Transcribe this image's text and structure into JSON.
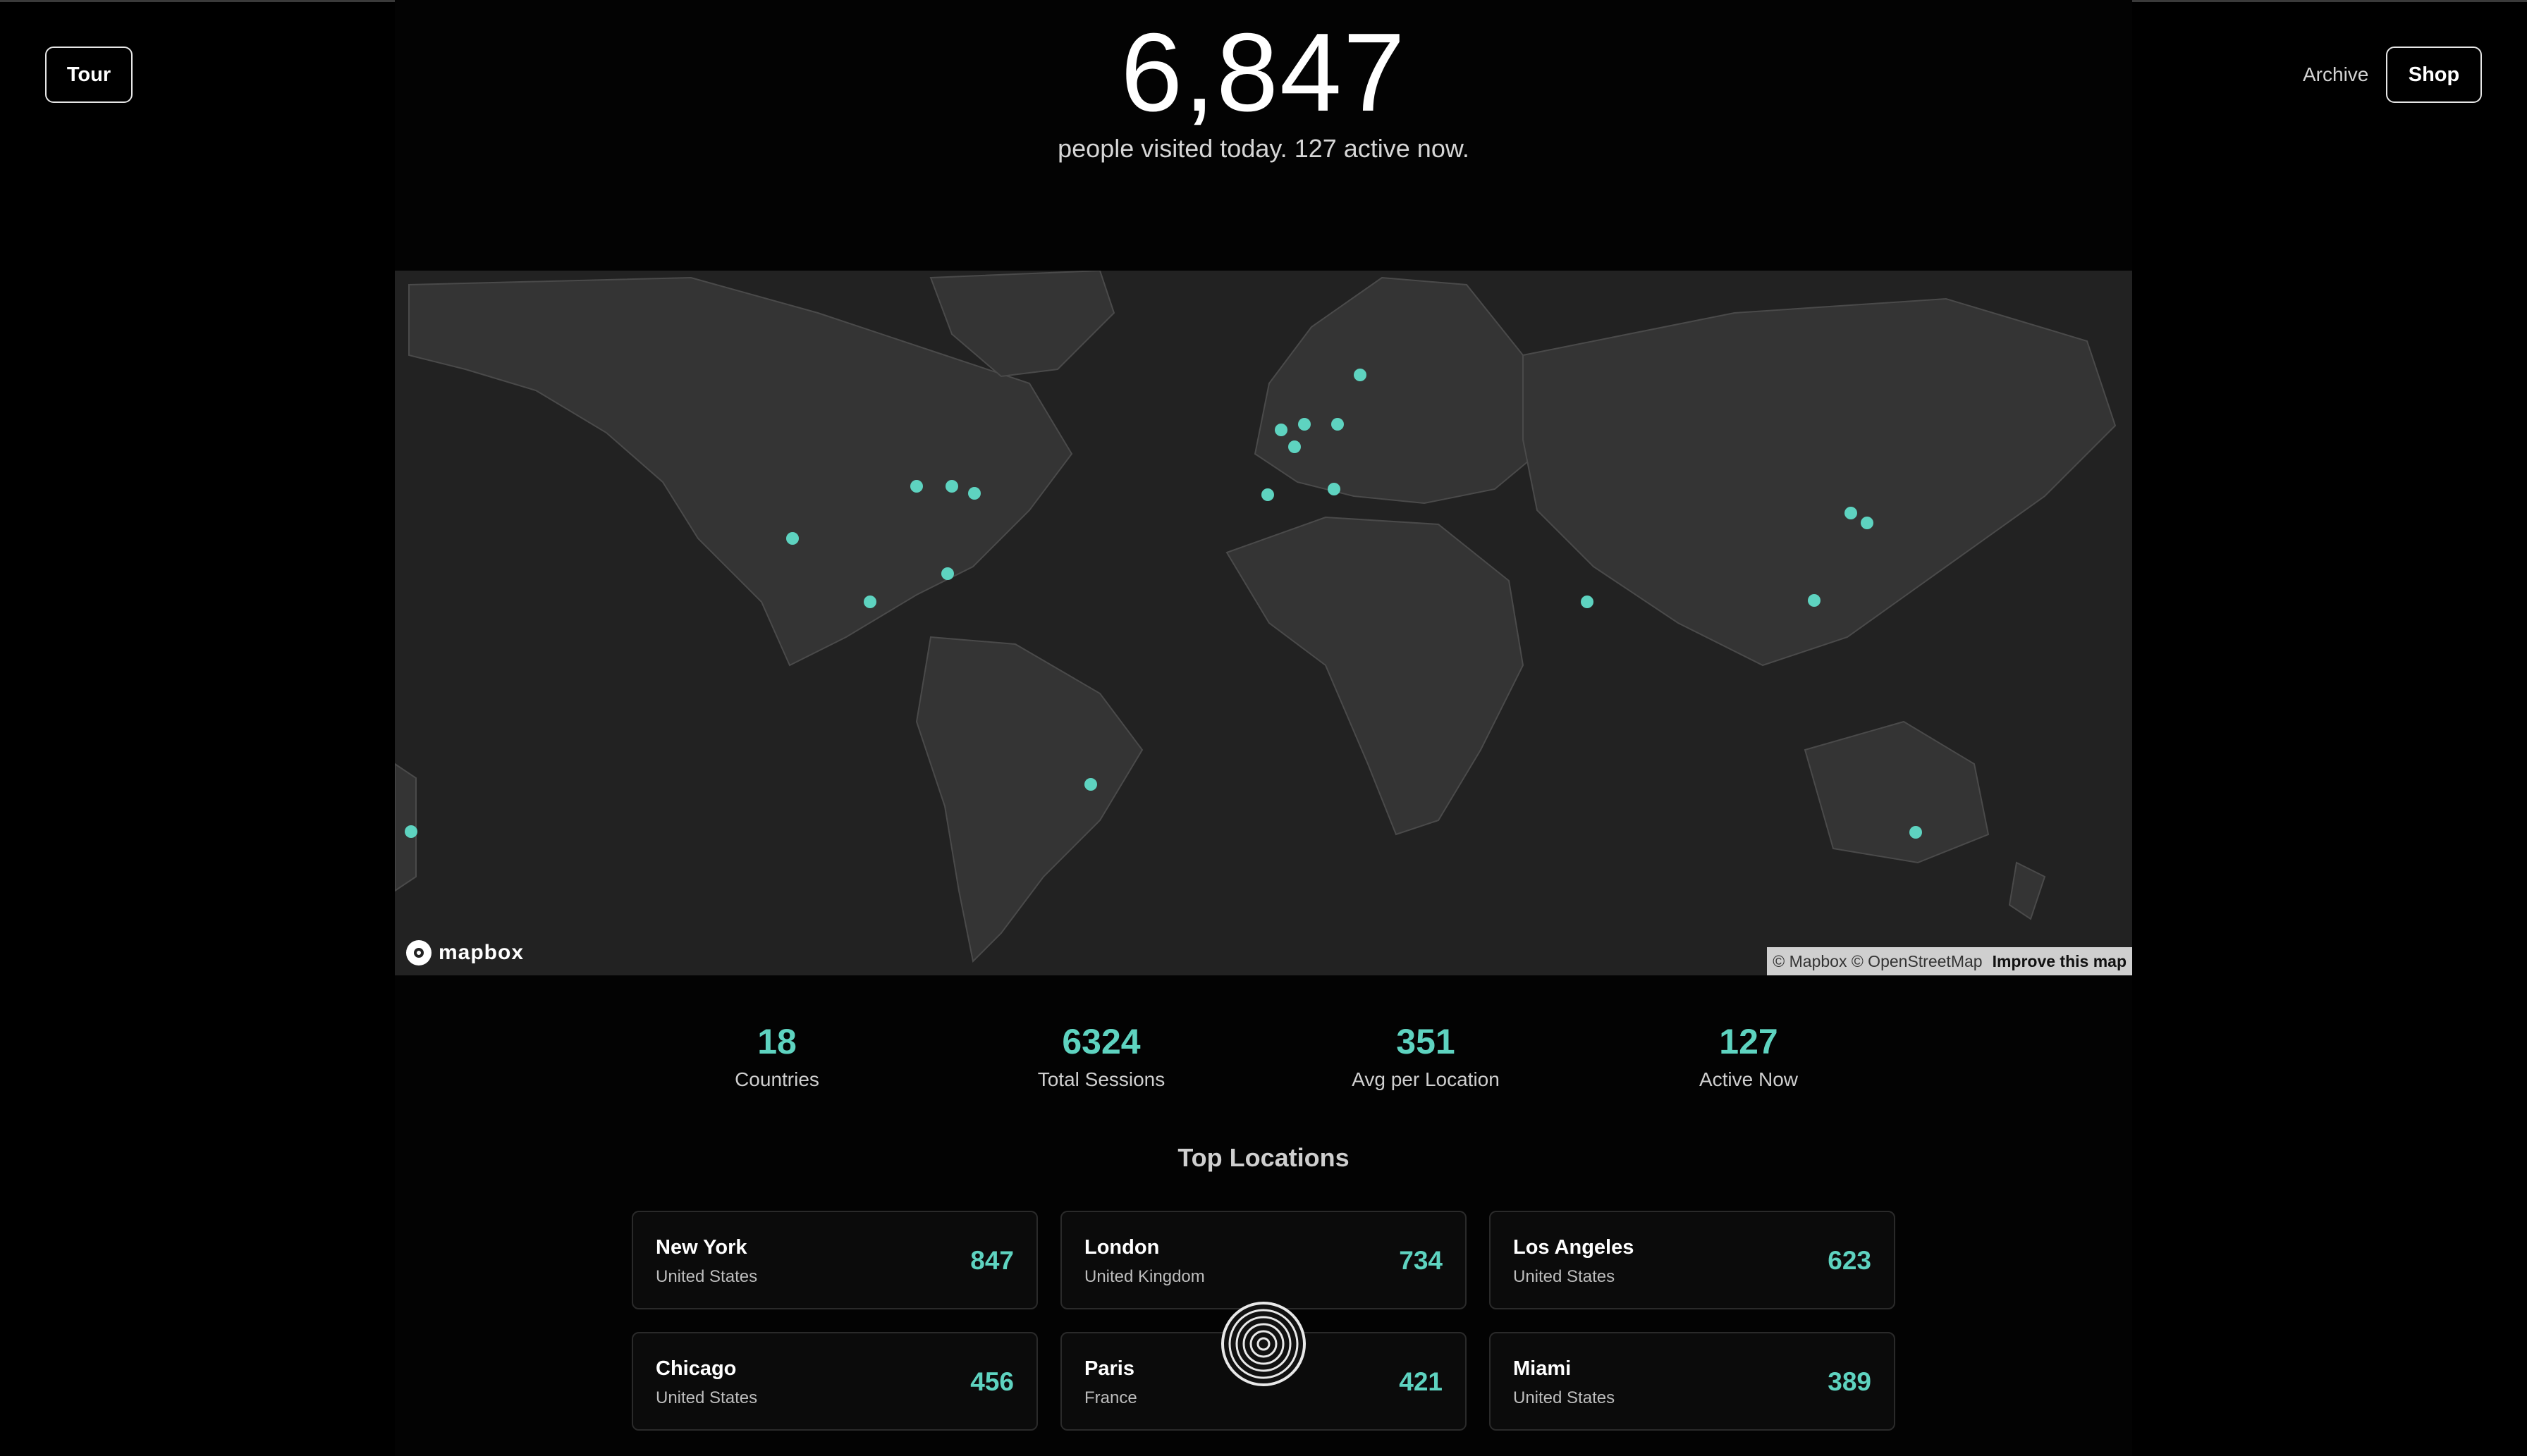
{
  "header": {
    "tour_label": "Tour",
    "archive_label": "Archive",
    "shop_label": "Shop",
    "visitor_count": "6,847",
    "subtitle": "people visited today. 127 active now."
  },
  "map": {
    "logo_text": "mapbox",
    "attribution": "© Mapbox © OpenStreetMap",
    "improve_link": "Improve this map",
    "marker_color": "#5ed3c0",
    "land_color": "#343434",
    "water_color": "#222222"
  },
  "stats": [
    {
      "value": "18",
      "label": "Countries"
    },
    {
      "value": "6324",
      "label": "Total Sessions"
    },
    {
      "value": "351",
      "label": "Avg per Location"
    },
    {
      "value": "127",
      "label": "Active Now"
    }
  ],
  "top_locations": {
    "title": "Top Locations",
    "items": [
      {
        "city": "New York",
        "country": "United States",
        "count": "847"
      },
      {
        "city": "London",
        "country": "United Kingdom",
        "count": "734"
      },
      {
        "city": "Los Angeles",
        "country": "United States",
        "count": "623"
      },
      {
        "city": "Chicago",
        "country": "United States",
        "count": "456"
      },
      {
        "city": "Paris",
        "country": "France",
        "count": "421"
      },
      {
        "city": "Miami",
        "country": "United States",
        "count": "389"
      }
    ]
  },
  "colors": {
    "accent": "#5ed3c0",
    "background": "#000000"
  }
}
